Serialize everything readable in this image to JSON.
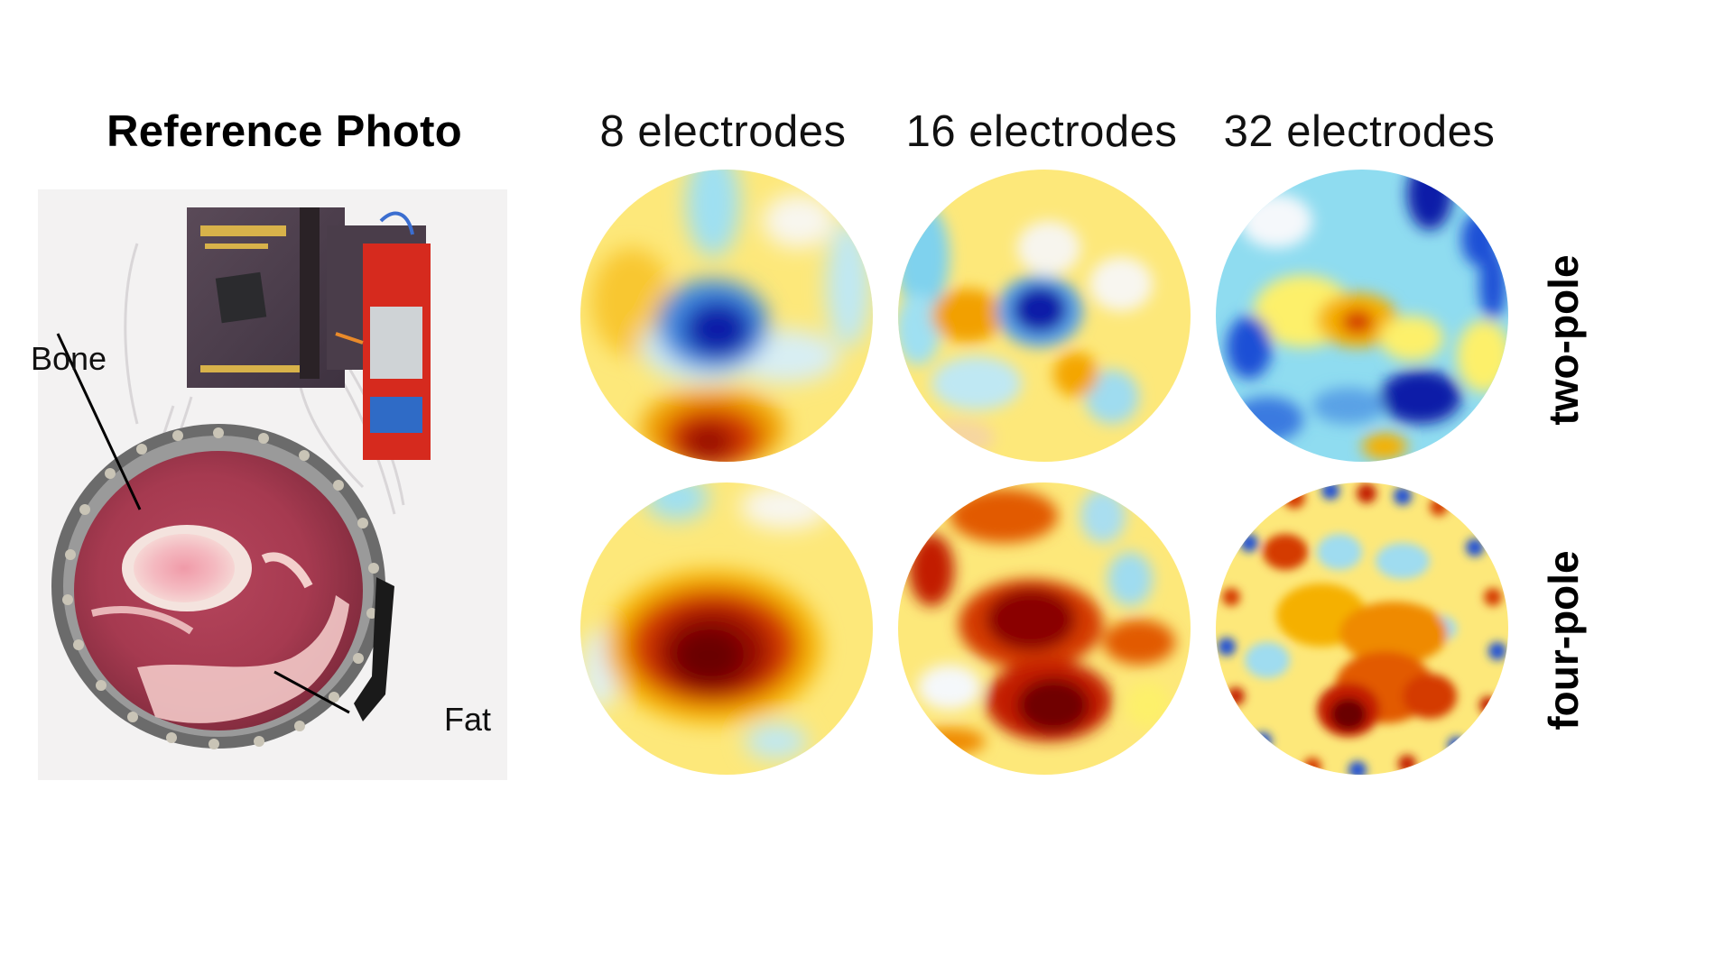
{
  "figure": {
    "reference_title": "Reference Photo",
    "columns": [
      "8 electrodes",
      "16 electrodes",
      "32 electrodes"
    ],
    "rows": [
      "two-pole",
      "four-pole"
    ],
    "annotations": {
      "bone": "Bone",
      "fat": "Fat"
    }
  },
  "colormap": {
    "name": "diverging blue-white-yellow-red",
    "stops": [
      "#00008a",
      "#1a4fd6",
      "#8fdcf0",
      "#f5f8fb",
      "#fdf06a",
      "#f5b000",
      "#d43a00",
      "#7a0000"
    ]
  },
  "maps": [
    {
      "row": "two-pole",
      "column": "8 electrodes",
      "pattern": "central blue minimum, red at bottom, yellow background"
    },
    {
      "row": "two-pole",
      "column": "16 electrodes",
      "pattern": "small dark-blue minimum slightly left of center, cyan left edge"
    },
    {
      "row": "two-pole",
      "column": "32 electrodes",
      "pattern": "cyan/blue dominated, blue patches top-right and bottom"
    },
    {
      "row": "four-pole",
      "column": "8 electrodes",
      "pattern": "dark red center, yellow background"
    },
    {
      "row": "four-pole",
      "column": "16 electrodes",
      "pattern": "red cross-shaped region spanning center"
    },
    {
      "row": "four-pole",
      "column": "32 electrodes",
      "pattern": "orange/red center with dark red lower-middle, noisy rim"
    }
  ]
}
